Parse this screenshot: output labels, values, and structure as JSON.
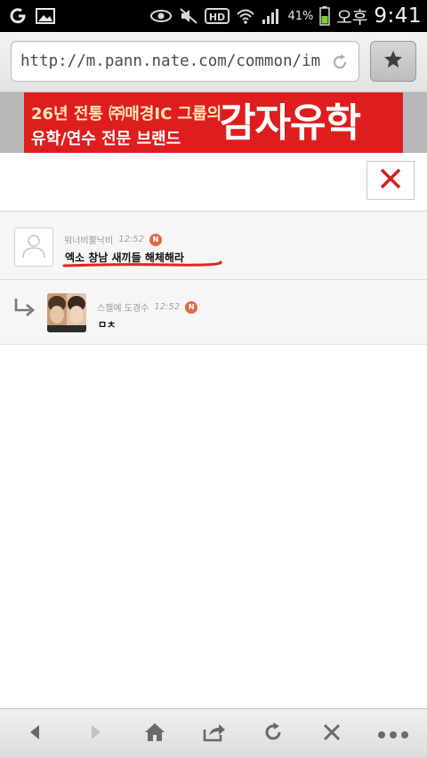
{
  "status_bar": {
    "battery_percent": "41%",
    "ampm": "오후",
    "time": "9:41"
  },
  "browser": {
    "url": "http://m.pann.nate.com/common/im"
  },
  "banner": {
    "line1": "26년 전통 ㈜매경IC 그룹의",
    "line2": "유학/연수 전문 브랜드",
    "title": "감자유학"
  },
  "comments": [
    {
      "author": "워너비뿔낙비",
      "time": "12:52",
      "badge": "N",
      "text": "엑소 창남 새끼들 해체해라",
      "underline_color": "#e0261e"
    },
    {
      "author": "스젤예 도경수",
      "time": "12:52",
      "badge": "N",
      "text": "ㅁㅊ"
    }
  ],
  "colors": {
    "accent_red": "#de1e1e",
    "close_x": "#d32020",
    "badge": "#e0684a"
  }
}
